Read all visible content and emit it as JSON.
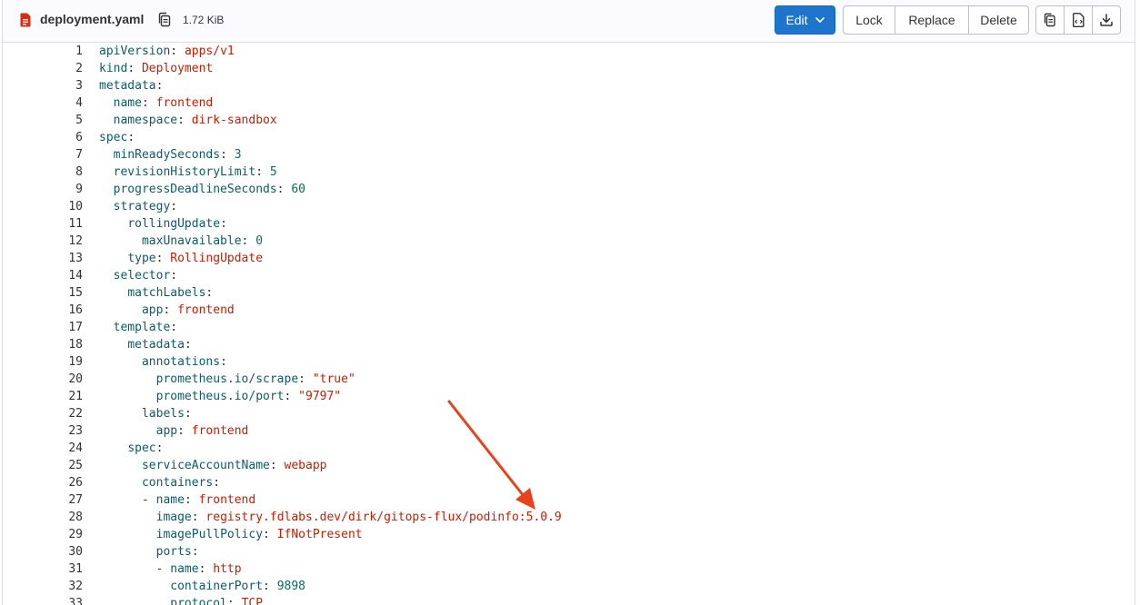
{
  "file": {
    "name": "deployment.yaml",
    "size": "1.72 KiB"
  },
  "toolbar": {
    "edit_label": "Edit",
    "lock_label": "Lock",
    "replace_label": "Replace",
    "delete_label": "Delete"
  },
  "icons": {
    "file": "yaml-file-icon",
    "copy_path": "copy-icon",
    "copy_contents": "copy-icon",
    "open_raw": "raw-file-icon",
    "download": "download-icon",
    "edit_caret": "chevron-down-icon"
  },
  "colors": {
    "primary": "#1f75cb",
    "key": "#0b5c68",
    "string_value": "#c91c00",
    "number_value": "#0b6b5a",
    "annotation_arrow": "#e8421c"
  },
  "code_lines": [
    {
      "num": "1",
      "indent": "",
      "key": "apiVersion",
      "sep": ": ",
      "value": "apps/v1",
      "type": "string"
    },
    {
      "num": "2",
      "indent": "",
      "key": "kind",
      "sep": ": ",
      "value": "Deployment",
      "type": "string"
    },
    {
      "num": "3",
      "indent": "",
      "key": "metadata",
      "sep": ":",
      "value": "",
      "type": "none"
    },
    {
      "num": "4",
      "indent": "  ",
      "key": "name",
      "sep": ": ",
      "value": "frontend",
      "type": "string"
    },
    {
      "num": "5",
      "indent": "  ",
      "key": "namespace",
      "sep": ": ",
      "value": "dirk-sandbox",
      "type": "string"
    },
    {
      "num": "6",
      "indent": "",
      "key": "spec",
      "sep": ":",
      "value": "",
      "type": "none"
    },
    {
      "num": "7",
      "indent": "  ",
      "key": "minReadySeconds",
      "sep": ": ",
      "value": "3",
      "type": "number"
    },
    {
      "num": "8",
      "indent": "  ",
      "key": "revisionHistoryLimit",
      "sep": ": ",
      "value": "5",
      "type": "number"
    },
    {
      "num": "9",
      "indent": "  ",
      "key": "progressDeadlineSeconds",
      "sep": ": ",
      "value": "60",
      "type": "number"
    },
    {
      "num": "10",
      "indent": "  ",
      "key": "strategy",
      "sep": ":",
      "value": "",
      "type": "none"
    },
    {
      "num": "11",
      "indent": "    ",
      "key": "rollingUpdate",
      "sep": ":",
      "value": "",
      "type": "none"
    },
    {
      "num": "12",
      "indent": "      ",
      "key": "maxUnavailable",
      "sep": ": ",
      "value": "0",
      "type": "number"
    },
    {
      "num": "13",
      "indent": "    ",
      "key": "type",
      "sep": ": ",
      "value": "RollingUpdate",
      "type": "string"
    },
    {
      "num": "14",
      "indent": "  ",
      "key": "selector",
      "sep": ":",
      "value": "",
      "type": "none"
    },
    {
      "num": "15",
      "indent": "    ",
      "key": "matchLabels",
      "sep": ":",
      "value": "",
      "type": "none"
    },
    {
      "num": "16",
      "indent": "      ",
      "key": "app",
      "sep": ": ",
      "value": "frontend",
      "type": "string"
    },
    {
      "num": "17",
      "indent": "  ",
      "key": "template",
      "sep": ":",
      "value": "",
      "type": "none"
    },
    {
      "num": "18",
      "indent": "    ",
      "key": "metadata",
      "sep": ":",
      "value": "",
      "type": "none"
    },
    {
      "num": "19",
      "indent": "      ",
      "key": "annotations",
      "sep": ":",
      "value": "",
      "type": "none"
    },
    {
      "num": "20",
      "indent": "        ",
      "key": "prometheus.io/scrape",
      "sep": ": ",
      "value": "\"true\"",
      "type": "string"
    },
    {
      "num": "21",
      "indent": "        ",
      "key": "prometheus.io/port",
      "sep": ": ",
      "value": "\"9797\"",
      "type": "string"
    },
    {
      "num": "22",
      "indent": "      ",
      "key": "labels",
      "sep": ":",
      "value": "",
      "type": "none"
    },
    {
      "num": "23",
      "indent": "        ",
      "key": "app",
      "sep": ": ",
      "value": "frontend",
      "type": "string"
    },
    {
      "num": "24",
      "indent": "    ",
      "key": "spec",
      "sep": ":",
      "value": "",
      "type": "none"
    },
    {
      "num": "25",
      "indent": "      ",
      "key": "serviceAccountName",
      "sep": ": ",
      "value": "webapp",
      "type": "string"
    },
    {
      "num": "26",
      "indent": "      ",
      "key": "containers",
      "sep": ":",
      "value": "",
      "type": "none"
    },
    {
      "num": "27",
      "indent": "      - ",
      "key": "name",
      "sep": ": ",
      "value": "frontend",
      "type": "string"
    },
    {
      "num": "28",
      "indent": "        ",
      "key": "image",
      "sep": ": ",
      "value": "registry.fdlabs.dev/dirk/gitops-flux/podinfo:5.0.9",
      "type": "string"
    },
    {
      "num": "29",
      "indent": "        ",
      "key": "imagePullPolicy",
      "sep": ": ",
      "value": "IfNotPresent",
      "type": "string"
    },
    {
      "num": "30",
      "indent": "        ",
      "key": "ports",
      "sep": ":",
      "value": "",
      "type": "none"
    },
    {
      "num": "31",
      "indent": "        - ",
      "key": "name",
      "sep": ": ",
      "value": "http",
      "type": "string"
    },
    {
      "num": "32",
      "indent": "          ",
      "key": "containerPort",
      "sep": ": ",
      "value": "9898",
      "type": "number"
    },
    {
      "num": "33",
      "indent": "          ",
      "key": "protocol",
      "sep": ": ",
      "value": "TCP",
      "type": "string"
    }
  ]
}
